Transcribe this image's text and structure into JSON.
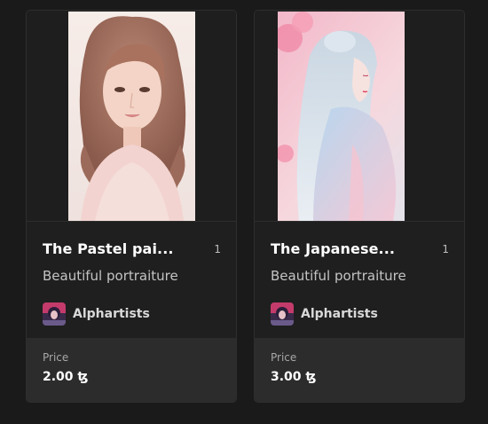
{
  "cards": [
    {
      "title": "The Pastel pai...",
      "edition": "1",
      "subtitle": "Beautiful portraiture",
      "creator": "Alphartists",
      "price_label": "Price",
      "price": "2.00 ꜩ"
    },
    {
      "title": "The Japanese...",
      "edition": "1",
      "subtitle": "Beautiful portraiture",
      "creator": "Alphartists",
      "price_label": "Price",
      "price": "3.00 ꜩ"
    }
  ],
  "colors": {
    "page_background": "#1a1a1a",
    "card_background": "#1f1f1f",
    "footer_background": "#2c2c2d",
    "text_primary": "#ffffff",
    "text_secondary": "#c4c4c4"
  }
}
